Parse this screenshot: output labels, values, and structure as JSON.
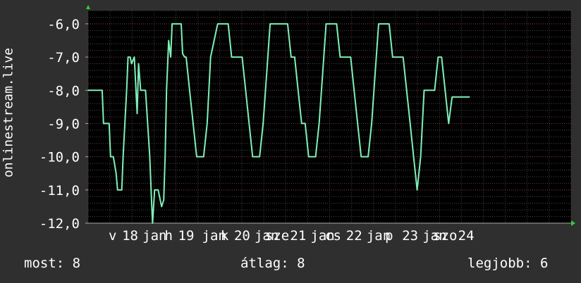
{
  "chart_data": {
    "type": "line",
    "ylabel": "onlinestream.live",
    "ylim": [
      -12,
      -5.6
    ],
    "yticks": [
      -12,
      -11,
      -10,
      -9,
      -8,
      -7,
      -6
    ],
    "ytick_labels": [
      "-12,0",
      "-11,0",
      "-10,0",
      "-9,0",
      "-8,0",
      "-7,0",
      "-6,0"
    ],
    "xlim": [
      0,
      6.9
    ],
    "xtick_labels": [
      "v",
      "18",
      "jan",
      "h",
      "19",
      "jan",
      "k",
      "20",
      "jan",
      "sze",
      "21",
      "jan",
      "cs",
      "22",
      "jan",
      "p",
      "23",
      "jan",
      "szo",
      "24"
    ],
    "xtick_pos": [
      0.35,
      0.6,
      0.95,
      1.15,
      1.4,
      1.8,
      1.95,
      2.2,
      2.55,
      2.7,
      3.0,
      3.35,
      3.5,
      3.8,
      4.15,
      4.3,
      4.6,
      4.95,
      5.1,
      5.4
    ],
    "grid": true,
    "line_color": "#7ff0b8",
    "series": [
      {
        "x": [
          0.0,
          0.1,
          0.2,
          0.22,
          0.3,
          0.32,
          0.36,
          0.4,
          0.42,
          0.48,
          0.5,
          0.55,
          0.57,
          0.6,
          0.62,
          0.66,
          0.7,
          0.72,
          0.75,
          0.78,
          0.8,
          0.82,
          0.85,
          0.88,
          0.9,
          0.92,
          0.95,
          1.0,
          1.05,
          1.08,
          1.1,
          1.12,
          1.15,
          1.18,
          1.2,
          1.22,
          1.25,
          1.28,
          1.3,
          1.33,
          1.35,
          1.38,
          1.4,
          1.45,
          1.5,
          1.55,
          1.6,
          1.62,
          1.65,
          1.7,
          1.75,
          1.8,
          1.85,
          1.9,
          1.95,
          2.0,
          2.05,
          2.1,
          2.15,
          2.2,
          2.25,
          2.3,
          2.35,
          2.4,
          2.45,
          2.5,
          2.55,
          2.6,
          2.65,
          2.7,
          2.75,
          2.8,
          2.85,
          2.9,
          2.95,
          3.0,
          3.05,
          3.1,
          3.15,
          3.2,
          3.25,
          3.3,
          3.35,
          3.4,
          3.45,
          3.5,
          3.55,
          3.6,
          3.65,
          3.7,
          3.75,
          3.8,
          3.85,
          3.9,
          3.95,
          4.0,
          4.05,
          4.1,
          4.15,
          4.2,
          4.25,
          4.3,
          4.35,
          4.4,
          4.45,
          4.5,
          4.55,
          4.6,
          4.65,
          4.7,
          4.75,
          4.8,
          4.85,
          4.9,
          4.95,
          5.0,
          5.05,
          5.1,
          5.15,
          5.2,
          5.25,
          5.3,
          5.35,
          5.4,
          5.45
        ],
        "y": [
          -8,
          -8,
          -8,
          -9,
          -9,
          -10,
          -10,
          -10.5,
          -11,
          -11,
          -10,
          -8,
          -7,
          -7,
          -7.2,
          -7,
          -8.7,
          -7.2,
          -8,
          -8,
          -8,
          -8,
          -9,
          -10,
          -11,
          -12,
          -11,
          -11,
          -11.5,
          -11.3,
          -10,
          -8,
          -6.5,
          -7,
          -6,
          -6,
          -6,
          -6,
          -6,
          -6,
          -6.9,
          -7,
          -7,
          -8,
          -9,
          -10,
          -10,
          -10,
          -10,
          -9,
          -7,
          -6.5,
          -6,
          -6,
          -6,
          -6,
          -7,
          -7,
          -7,
          -7,
          -8,
          -9,
          -10,
          -10,
          -10,
          -9,
          -7.5,
          -6,
          -6,
          -6,
          -6,
          -6,
          -6,
          -7,
          -7,
          -8,
          -9,
          -9,
          -10,
          -10,
          -10,
          -9,
          -7.5,
          -6,
          -6,
          -6,
          -6,
          -7,
          -7,
          -7,
          -7,
          -8,
          -9,
          -10,
          -10,
          -10,
          -9,
          -7.5,
          -6,
          -6,
          -6,
          -6,
          -7,
          -7,
          -7,
          -7,
          -8,
          -9,
          -10,
          -11,
          -10,
          -8,
          -8,
          -8,
          -8,
          -7,
          -7,
          -8,
          -9,
          -8.2,
          -8.2,
          -8.2,
          -8.2,
          -8.2,
          -8.2
        ]
      }
    ]
  },
  "stats": {
    "now": "most: 8",
    "avg": "átlag: 8",
    "best": "legjobb: 6"
  }
}
